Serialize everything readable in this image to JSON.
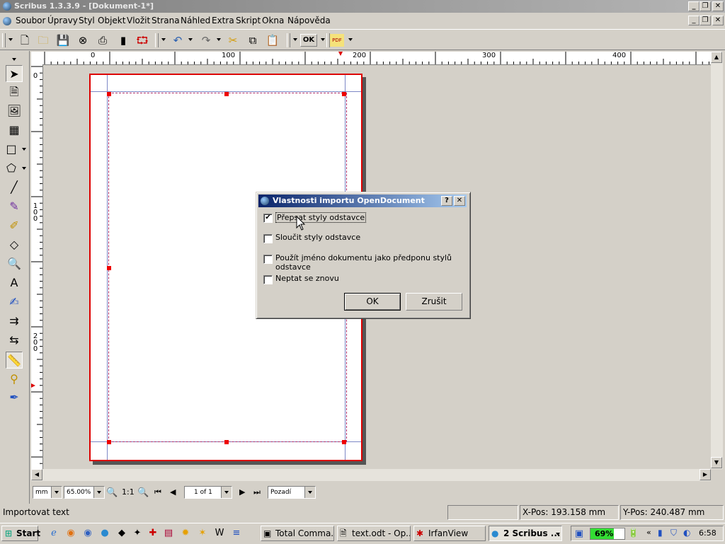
{
  "window": {
    "title": "Scribus 1.3.3.9 - [Dokument-1*]"
  },
  "menu": [
    "Soubor",
    "Úpravy",
    "Styl",
    "Objekt",
    "Vložit",
    "Strana",
    "Náhled",
    "Extra",
    "Skript",
    "Okna",
    "Nápověda"
  ],
  "toolbar": {
    "ok_label": "OK",
    "pdf_label": "PDF"
  },
  "ruler": {
    "h_ticks": [
      "0",
      "100",
      "200",
      "300",
      "400"
    ],
    "v_ticks": [
      "0",
      "100",
      "200"
    ]
  },
  "bottombar": {
    "unit": "mm",
    "zoom": "65.00%",
    "zoom_ratio": "1:1",
    "page": "1 of 1",
    "layer": "Pozadí"
  },
  "statusbar": {
    "message": "Importovat text",
    "xpos_label": "X-Pos:",
    "xpos_value": "193.158 mm",
    "ypos_label": "Y-Pos:",
    "ypos_value": "240.487 mm"
  },
  "taskbar": {
    "start": "Start",
    "tasks": [
      "Total Comma...",
      "text.odt - Op...",
      "IrfanView",
      "2 Scribus ..."
    ],
    "battery": "69%",
    "clock": "6:58"
  },
  "dialog": {
    "title": "Vlastnosti importu OpenDocument",
    "help_button": "?",
    "close_button": "✕",
    "options": [
      {
        "label": "Přepsat styly odstavce",
        "checked": true
      },
      {
        "label": "Sloučit styly odstavce",
        "checked": false
      },
      {
        "label": "Použít jméno dokumentu jako předponu stylů odstavce",
        "checked": false
      },
      {
        "label": "Neptat se znovu",
        "checked": false
      }
    ],
    "ok": "OK",
    "cancel": "Zrušit"
  },
  "colors": {
    "page_border": "#dd0000",
    "dialog_title": "#0a246a",
    "battery": "#33dd33"
  }
}
